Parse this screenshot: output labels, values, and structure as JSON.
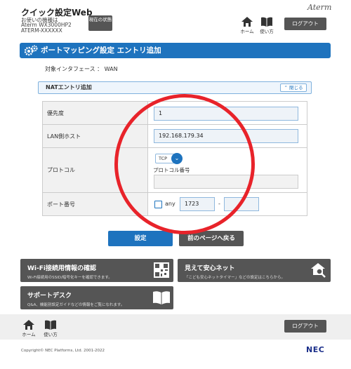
{
  "header": {
    "app_title": "クイック設定Web",
    "device_label": "お使いの機種は",
    "device_model": "Aterm WX3000HP2",
    "device_name": "ATERM-XXXXXX",
    "status_button": "現在の状態",
    "brand": "Aterm",
    "home_label": "ホーム",
    "howto_label": "使い方",
    "logout_label": "ログアウト"
  },
  "page": {
    "title": "ポートマッピング設定 エントリ追加",
    "interface_text": "対象インタフェース ： WAN"
  },
  "section": {
    "title": "NATエントリ追加",
    "collapse_label": "閉じる"
  },
  "form": {
    "priority_label": "優先度",
    "priority_value": "1",
    "lan_host_label": "LAN側ホスト",
    "lan_host_value": "192.168.179.34",
    "protocol_label": "プロトコル",
    "protocol_value": "TCP",
    "protocol_number_label": "プロトコル番号",
    "protocol_number_value": "",
    "port_label": "ポート番号",
    "port_any_label": "any",
    "port_from": "1723",
    "port_sep": "-",
    "port_to": ""
  },
  "buttons": {
    "submit": "設定",
    "back": "前のページへ戻る"
  },
  "tiles": {
    "wifi_title": "Wi-Fi接続用情報の確認",
    "wifi_desc": "Wi-Fi接続用のSSID/暗号化キーを確認できます。",
    "safety_title": "見えて安心ネット",
    "safety_desc": "「こども安心ネットタイマー」などの設定はこちらから。",
    "support_title": "サポートデスク",
    "support_desc": "Q&A、機能別設定ガイドなどの情報をご覧になれます。"
  },
  "footer": {
    "home_label": "ホーム",
    "howto_label": "使い方",
    "logout_label": "ログアウト",
    "copyright": "Copyright© NEC Platforms, Ltd. 2001-2022",
    "nec_logo": "NEC"
  },
  "colors": {
    "accent_blue": "#1e73be",
    "dark_gray": "#555555",
    "annotation_red": "#e8232a"
  }
}
